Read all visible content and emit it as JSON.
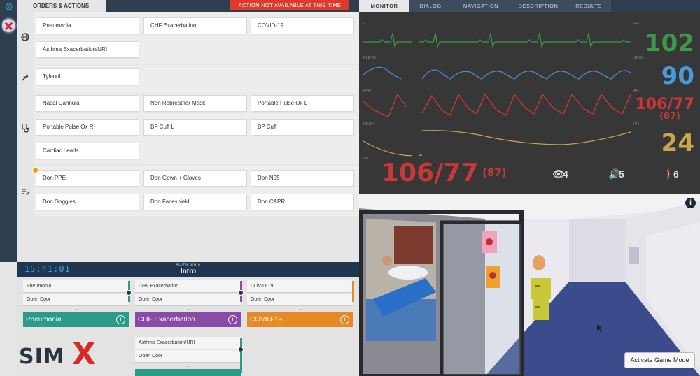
{
  "header": {
    "orders_tab": "ORDERS & ACTIONS",
    "warning": "ACTION NOT AVAILABLE AT THIS TIME"
  },
  "orders": {
    "row1": [
      "Pneumonia",
      "CHF Exacerbation",
      "COVID-19"
    ],
    "row2": [
      "Asthma Exacerbation/URI"
    ],
    "meds": [
      "Tylenol"
    ],
    "equip1": [
      "Nasal Cannula",
      "Non Rebreather Mask",
      "Portable Pulse Ox L"
    ],
    "equip2": [
      "Portable Pulse Ox R",
      "BP Cuff L",
      "BP Cuff"
    ],
    "equip3": [
      "Cardiac Leads"
    ],
    "ppe1": [
      "Don PPE",
      "Don Gown + Gloves",
      "Don N95"
    ],
    "ppe2": [
      "Don Goggles",
      "Don Faceshield",
      "Don CAPR"
    ]
  },
  "status": {
    "timer": "15:41:01",
    "active_state_label": "ACTIVE STATE",
    "active_state": "Intro",
    "cards": [
      {
        "title": "Pneumonia",
        "action": "Open Door",
        "state": "Pneumonia",
        "color": "#2b9b8a",
        "stripe": "#2b9b8a"
      },
      {
        "title": "CHF Exacerbation",
        "action": "Open Door",
        "state": "CHF Exacerbation",
        "color": "#8a4aa8",
        "stripe": "#8a4aa8"
      },
      {
        "title": "COVID-19",
        "action": "Open Door",
        "state": "COVID-19",
        "color": "#e58a25",
        "stripe": "#e58a25"
      }
    ],
    "card4": {
      "title": "Asthma Exacerbation/URI",
      "action": "Open Door"
    },
    "info_glyph": "i",
    "chevron": "⌄"
  },
  "logo": {
    "text": "SIM",
    "mark": "X"
  },
  "right_tabs": [
    "MONITOR",
    "DIALOG",
    "NAVIGATION",
    "DESCRIPTION",
    "RESULTS"
  ],
  "monitor": {
    "labels": {
      "ecg": "II",
      "pleth": "PLETH",
      "map": "MAP",
      "resp": "RESP",
      "bp": "BP",
      "hr": "HR",
      "spo2": "SPO2",
      "art": "ART",
      "rr": "RR"
    },
    "hr": "102",
    "spo2": "90",
    "art": "106/77",
    "art_sub": "(87)",
    "rr": "24",
    "bp_big": "106/77",
    "bp_sub": "(87)",
    "eye_count": "4",
    "sound_count": "5",
    "walk_count": "6",
    "colors": {
      "hr": "#3a9a48",
      "spo2": "#4a9ad8",
      "art": "#c83838",
      "rr": "#c8a848"
    }
  },
  "scene": {
    "game_button": "Activate Game Mode",
    "info": "i"
  }
}
